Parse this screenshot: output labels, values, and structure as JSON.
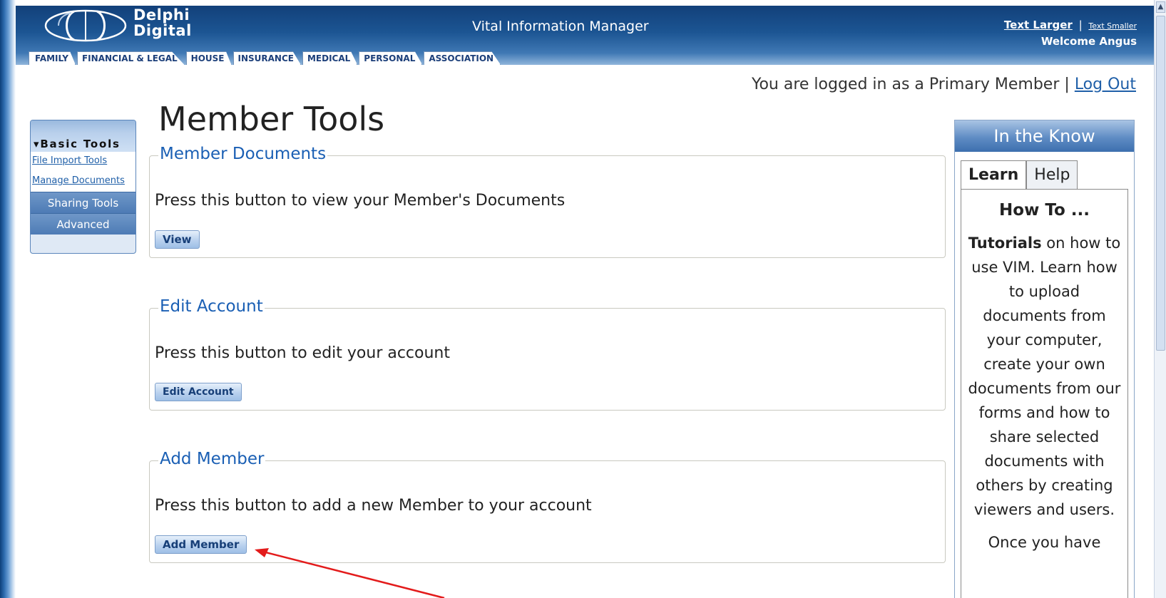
{
  "header": {
    "logo_line1": "Delphi",
    "logo_line2": "Digital",
    "app_title": "Vital Information Manager",
    "text_larger": "Text Larger",
    "separator": "|",
    "text_smaller": "Text Smaller",
    "welcome": "Welcome Angus",
    "tabs": [
      "FAMILY",
      "FINANCIAL & LEGAL",
      "HOUSE",
      "INSURANCE",
      "MEDICAL",
      "PERSONAL",
      "ASSOCIATION"
    ]
  },
  "login": {
    "text": "You are logged in as a Primary Member",
    "separator": "|",
    "logout": "Log Out"
  },
  "leftnav": {
    "header": "▾Basic Tools",
    "links": [
      "File Import Tools",
      "Manage Documents"
    ],
    "sections": [
      "Sharing Tools",
      "Advanced"
    ]
  },
  "main": {
    "title": "Member Tools",
    "panels": [
      {
        "legend": "Member Documents",
        "desc": "Press this button to view your Member's Documents",
        "button": "View"
      },
      {
        "legend": "Edit Account",
        "desc": "Press this button to edit your account",
        "button": "Edit Account"
      },
      {
        "legend": "Add Member",
        "desc": "Press this button to add a new Member to your account",
        "button": "Add Member"
      }
    ]
  },
  "know": {
    "title": "In the Know",
    "tabs": [
      "Learn",
      "Help"
    ],
    "heading": "How To ...",
    "tutorials_bold": "Tutorials",
    "tutorials_text": " on how to use VIM. Learn how to upload documents from your computer, create your own documents from our forms and how to share selected documents with others by creating viewers and users.",
    "more": "Once you have"
  },
  "colors": {
    "header_blue": "#1c5593",
    "link_blue": "#1f5fa8",
    "legend_blue": "#1a5fb4",
    "arrow_red": "#e31b1b"
  }
}
